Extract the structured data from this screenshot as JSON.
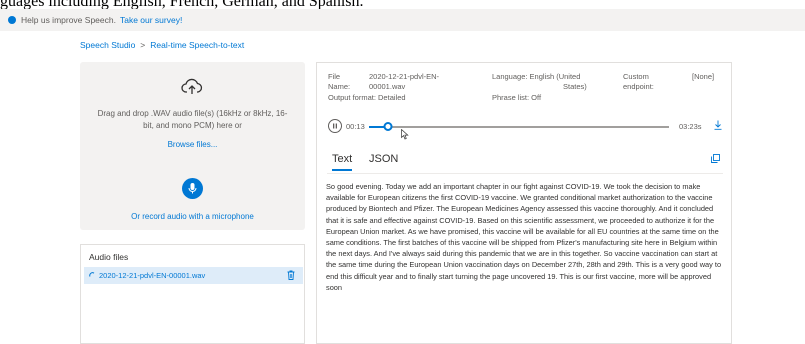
{
  "caption": "guages including English, French, German, and Spanish.",
  "survey": {
    "text": "Help us improve Speech.",
    "link": "Take our survey!"
  },
  "breadcrumb": {
    "root": "Speech Studio",
    "separator": ">",
    "current": "Real-time Speech-to-text"
  },
  "upload": {
    "instructions": "Drag and drop .WAV audio file(s) (16kHz or 8kHz, 16-bit, and mono PCM) here or",
    "browse": "Browse files...",
    "record": "Or record audio with a microphone"
  },
  "audio_files": {
    "title": "Audio files",
    "items": [
      {
        "name": "2020-12-21-pdvl-EN-00001.wav"
      }
    ]
  },
  "details": {
    "file_label": "File",
    "file_value_1": "2020-12-21-pdvl-EN-",
    "name_label": "Name:",
    "file_value_2": "00001.wav",
    "output_format": "Output format: Detailed",
    "language_label": "Language: English (United",
    "language_value_2": "States)",
    "phrase_list": "Phrase list: Off",
    "endpoint_label_1": "Custom",
    "endpoint_label_2": "endpoint:",
    "endpoint_value": "[None]"
  },
  "player": {
    "current_time": "00:13",
    "total_time": "03:23s",
    "progress": 0.064
  },
  "tabs": [
    "Text",
    "JSON"
  ],
  "transcript": "So good evening. Today we add an important chapter in our fight against COVID-19. We took the decision to make available for European citizens the first COVID-19 vaccine. We granted conditional market authorization to the vaccine produced by Biontech and Pfizer. The European Medicines Agency assessed this vaccine thoroughly. And it concluded that it is safe and effective against COVID-19. Based on this scientific assessment, we proceeded to authorize it for the European Union market. As we have promised, this vaccine will be available for all EU countries at the same time on the same conditions. The first batches of this vaccine will be shipped from Pfizer's manufacturing site here in Belgium within the next days. And I've always said during this pandemic that we are in this together. So vaccine vaccination can start at the same time during the European Union vaccination days on December 27th, 28th and 29th. This is a very good way to end this difficult year and to finally start turning the page uncovered 19. This is our first vaccine, more will be approved soon",
  "colors": {
    "accent": "#0078d4",
    "panel_bg": "#f3f2f1",
    "selected_row": "#deecf9"
  }
}
